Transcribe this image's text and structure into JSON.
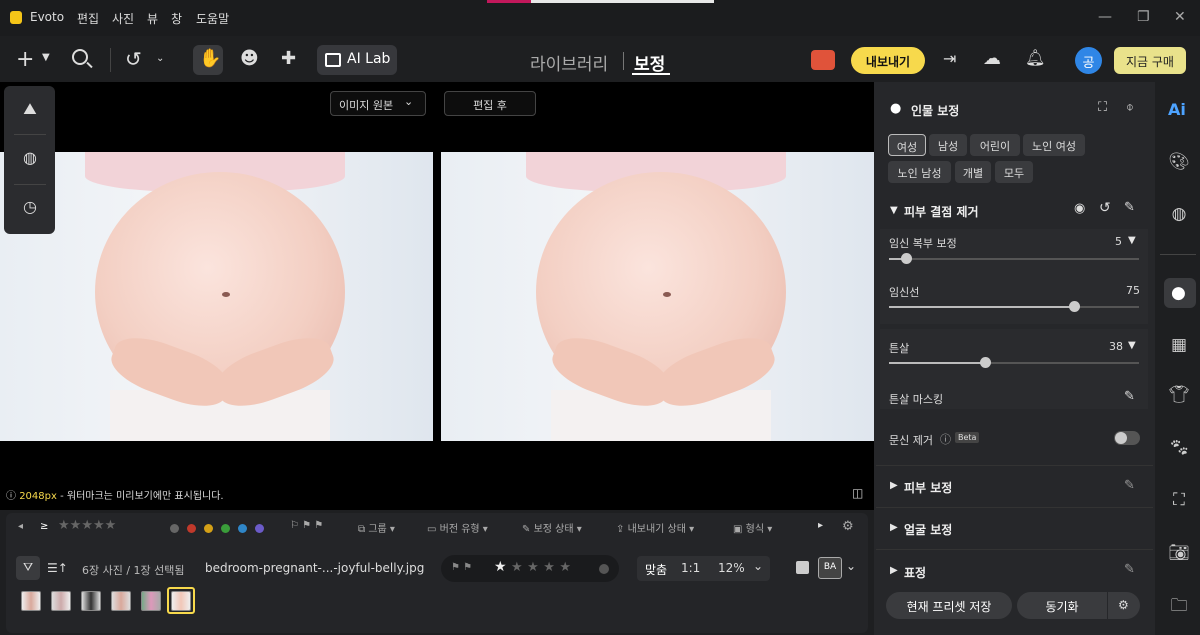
{
  "titlebar": {
    "app_name": "Evoto",
    "menus": [
      "편집",
      "사진",
      "뷰",
      "창",
      "도움말"
    ]
  },
  "toolbar": {
    "ai_lab": "AI Lab",
    "nav_library": "라이브러리",
    "nav_edit": "보정",
    "export": "내보내기",
    "avatar_initial": "공",
    "buy": "지금 구매"
  },
  "canvas": {
    "original_select": "이미지 원본",
    "after_button": "편집 후",
    "info_px": "2048px",
    "info_text": " - 워터마크는 미리보기에만 표시됩니다."
  },
  "filter_bar": {
    "group": "그룹",
    "version_type": "버전 유형",
    "edit_status": "보정 상태",
    "export_status": "내보내기 상태",
    "format": "형식",
    "colors": [
      "#666666",
      "#c0392b",
      "#d4a017",
      "#3a9d3a",
      "#2f86c8",
      "#6b5bc8"
    ]
  },
  "browser": {
    "count": "6장 사진 / 1장 선택됨",
    "filename": "bedroom-pregnant-...-joyful-belly.jpg",
    "fit": "맞춤",
    "one_to_one": "1:1",
    "zoom": "12%"
  },
  "panel": {
    "title": "인물 보정",
    "pills_row1": [
      "여성",
      "남성",
      "어린이",
      "노인 여성"
    ],
    "pills_row2": [
      "노인 남성",
      "개별",
      "모두"
    ],
    "section_blemish": "피부 결점 제거",
    "sliders": [
      {
        "label": "임신 복부 보정",
        "value": "5"
      },
      {
        "label": "임신선",
        "value": "75"
      },
      {
        "label": "튼살",
        "value": "38"
      }
    ],
    "stretch_masking": "튼살 마스킹",
    "tattoo": "문신 제거",
    "beta": "Beta",
    "section_skin": "피부 보정",
    "section_face": "얼굴 보정",
    "section_expression": "표정",
    "save_preset": "현재 프리셋 저장",
    "sync": "동기화"
  },
  "right_bar": {
    "ai_label": "Ai"
  }
}
